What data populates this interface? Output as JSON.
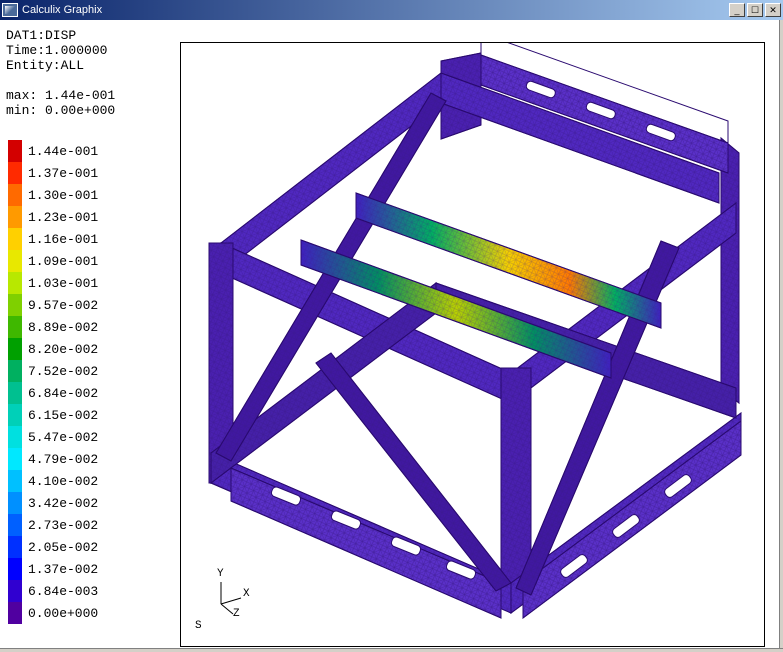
{
  "window": {
    "title": "Calculix Graphix",
    "minimize_glyph": "_",
    "maximize_glyph": "☐",
    "close_glyph": "✕"
  },
  "info": {
    "dataset": "DAT1:DISP",
    "time_label": "Time:1.000000",
    "entity_label": "Entity:ALL",
    "max_label": "max: 1.44e-001",
    "min_label": "min: 0.00e+000"
  },
  "legend": [
    {
      "color": "#d30000",
      "label": "1.44e-001"
    },
    {
      "color": "#ff2a00",
      "label": "1.37e-001"
    },
    {
      "color": "#ff6a00",
      "label": "1.30e-001"
    },
    {
      "color": "#ff9a00",
      "label": "1.23e-001"
    },
    {
      "color": "#ffd000",
      "label": "1.16e-001"
    },
    {
      "color": "#e8e800",
      "label": "1.09e-001"
    },
    {
      "color": "#b8e800",
      "label": "1.03e-001"
    },
    {
      "color": "#7fd000",
      "label": "9.57e-002"
    },
    {
      "color": "#3fb800",
      "label": "8.89e-002"
    },
    {
      "color": "#00a000",
      "label": "8.20e-002"
    },
    {
      "color": "#00b060",
      "label": "7.52e-002"
    },
    {
      "color": "#00c090",
      "label": "6.84e-002"
    },
    {
      "color": "#00d0b8",
      "label": "6.15e-002"
    },
    {
      "color": "#00e0e0",
      "label": "5.47e-002"
    },
    {
      "color": "#00e8ff",
      "label": "4.79e-002"
    },
    {
      "color": "#00c0ff",
      "label": "4.10e-002"
    },
    {
      "color": "#0090ff",
      "label": "3.42e-002"
    },
    {
      "color": "#0060ff",
      "label": "2.73e-002"
    },
    {
      "color": "#0030ff",
      "label": "2.05e-002"
    },
    {
      "color": "#0000ff",
      "label": "1.37e-002"
    },
    {
      "color": "#3000d0",
      "label": "6.84e-003"
    },
    {
      "color": "#5000a0",
      "label": "0.00e+000"
    }
  ],
  "axis": {
    "x": "X",
    "y": "Y",
    "z": "Z"
  },
  "s_label": "S"
}
